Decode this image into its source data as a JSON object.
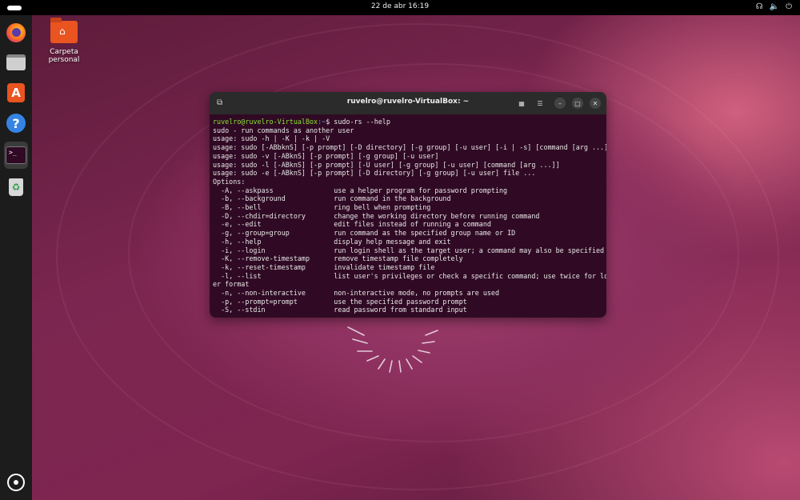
{
  "topbar": {
    "datetime": "22 de abr  16:19",
    "tray_icons": [
      "network-icon",
      "volume-icon",
      "power-icon"
    ]
  },
  "dock": {
    "items": [
      {
        "name": "Firefox",
        "icon": "firefox-icon"
      },
      {
        "name": "Files",
        "icon": "files-icon"
      },
      {
        "name": "App Center",
        "icon": "app-center-icon"
      },
      {
        "name": "Help",
        "icon": "help-icon"
      },
      {
        "name": "Terminal",
        "icon": "terminal-icon",
        "active": true
      },
      {
        "name": "Trash",
        "icon": "trash-icon"
      }
    ],
    "apps_icon": "show-apps-icon"
  },
  "desktop": {
    "home_folder_label": "Carpeta personal"
  },
  "terminal": {
    "title": "ruvelro@ruvelro-VirtualBox: ~",
    "prompt_user": "ruvelro@ruvelro-VirtualBox",
    "prompt_path": ":~",
    "prompt_symbol": "$ ",
    "command": "sudo-rs --help",
    "output": [
      "sudo - run commands as another user",
      "usage: sudo -h | -K | -k | -V",
      "usage: sudo [-ABbknS] [-p prompt] [-D directory] [-g group] [-u user] [-i | -s] [command [arg ...]]",
      "usage: sudo -v [-ABknS] [-p prompt] [-g group] [-u user]",
      "usage: sudo -l [-ABknS] [-p prompt] [-U user] [-g group] [-u user] [command [arg ...]]",
      "usage: sudo -e [-ABknS] [-p prompt] [-D directory] [-g group] [-u user] file ...",
      "Options:",
      "  -A, --askpass               use a helper program for password prompting",
      "  -b, --background            run command in the background",
      "  -B, --bell                  ring bell when prompting",
      "  -D, --chdir=directory       change the working directory before running command",
      "  -e, --edit                  edit files instead of running a command",
      "  -g, --group=group           run command as the specified group name or ID",
      "  -h, --help                  display help message and exit",
      "  -i, --login                 run login shell as the target user; a command may also be specified",
      "  -K, --remove-timestamp      remove timestamp file completely",
      "  -k, --reset-timestamp       invalidate timestamp file",
      "  -l, --list                  list user's privileges or check a specific command; use twice for long",
      "er format",
      "  -n, --non-interactive       non-interactive mode, no prompts are used",
      "  -p, --prompt=prompt         use the specified password prompt",
      "  -S, --stdin                 read password from standard input"
    ]
  },
  "colors": {
    "terminal_bg": "#300a24",
    "prompt_user": "#8ae234",
    "prompt_path": "#729fcf",
    "accent": "#e95420"
  }
}
